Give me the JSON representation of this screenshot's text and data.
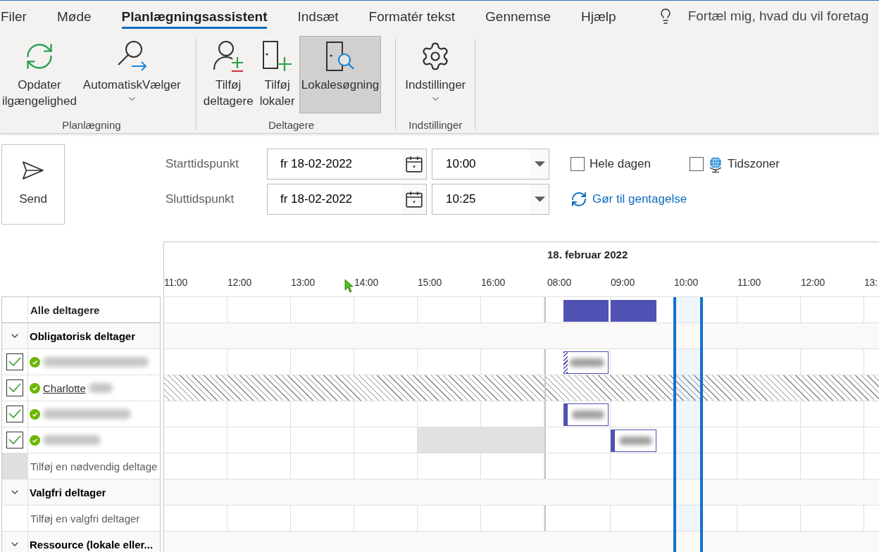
{
  "ribbon_tabs": [
    {
      "label": "Filer",
      "selected": false
    },
    {
      "label": "Møde",
      "selected": false
    },
    {
      "label": "Planlægningsassistent",
      "selected": true
    },
    {
      "label": "Indsæt",
      "selected": false
    },
    {
      "label": "Formatér tekst",
      "selected": false
    },
    {
      "label": "Gennemse",
      "selected": false
    },
    {
      "label": "Hjælp",
      "selected": false
    }
  ],
  "tell_me": {
    "placeholder": "Fortæl mig, hvad du vil foretag"
  },
  "ribbon_groups": [
    {
      "label": "Planlægning",
      "buttons": [
        {
          "label": "Opdater ilgængelighed",
          "menu": false,
          "pressed": false
        },
        {
          "label": "AutomatiskVælger",
          "menu": true,
          "pressed": false
        }
      ]
    },
    {
      "label": "Deltagere",
      "buttons": [
        {
          "label": "Tilføj deltagere",
          "menu": false,
          "pressed": false
        },
        {
          "label": "Tilføj lokaler",
          "menu": false,
          "pressed": false
        },
        {
          "label": "Lokalesøgning",
          "menu": false,
          "pressed": true
        }
      ]
    },
    {
      "label": "Indstillinger",
      "buttons": [
        {
          "label": "Indstillinger",
          "menu": true,
          "pressed": false
        }
      ]
    }
  ],
  "send_button": {
    "label": "Send"
  },
  "time_fields": [
    {
      "label": "Starttidspunkt",
      "date": "fr 18-02-2022",
      "time": "10:00"
    },
    {
      "label": "Sluttidspunkt",
      "date": "fr 18-02-2022",
      "time": "10:25"
    }
  ],
  "all_day": {
    "label": "Hele dagen",
    "checked": false
  },
  "time_zones": {
    "label": "Tidszoner",
    "checked": false
  },
  "recurrence_link": {
    "label": "Gør til gentagelse"
  },
  "scheduling": {
    "timeline": {
      "segments": [
        {
          "hours": [
            "11:00",
            "12:00",
            "13:00",
            "14:00",
            "15:00",
            "16:00"
          ]
        },
        {
          "title": "18. februar 2022",
          "hours": [
            "08:00",
            "09:00",
            "10:00",
            "11:00",
            "12:00",
            "13:"
          ]
        }
      ]
    },
    "all_attendees": {
      "label": "Alle deltagere",
      "busy": [
        {
          "kind": "merged"
        },
        {
          "kind": "merged"
        }
      ]
    },
    "sections": [
      {
        "title": "Obligatorisk deltager",
        "expanded": true,
        "attendees": [
          {
            "checked": true,
            "available": true,
            "redacted": true,
            "availability_known": true,
            "busy": [
              {
                "kind": "tentative",
                "redacted": true
              }
            ]
          },
          {
            "checked": true,
            "available": true,
            "name": "Charlotte",
            "redacted": true,
            "availability_known": false
          },
          {
            "checked": true,
            "available": true,
            "redacted": true,
            "availability_known": true,
            "busy": [
              {
                "kind": "busy",
                "redacted": true
              }
            ]
          },
          {
            "checked": true,
            "available": true,
            "redacted": true,
            "availability_known": true,
            "busy": [
              {
                "kind": "elsewhere"
              },
              {
                "kind": "busy",
                "redacted": true
              }
            ]
          }
        ],
        "add_field": {
          "placeholder": "Tilføj en nødvendig deltage",
          "selected": true
        }
      },
      {
        "title": "Valgfri deltager",
        "expanded": true,
        "add_field": {
          "placeholder": "Tilføj en valgfri deltager",
          "selected": false
        }
      },
      {
        "title": "Ressource (lokale eller...",
        "expanded": true
      }
    ]
  }
}
